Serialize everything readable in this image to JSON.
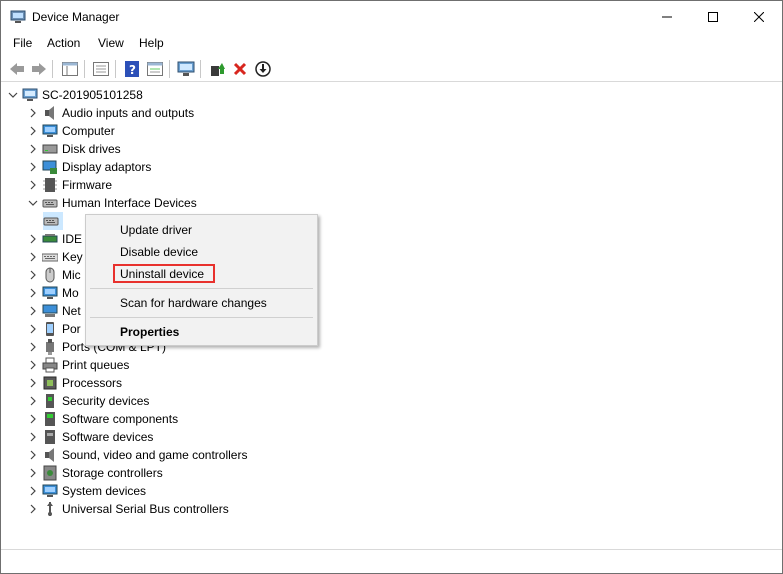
{
  "window": {
    "title": "Device Manager"
  },
  "menu": [
    "File",
    "Action",
    "View",
    "Help"
  ],
  "toolbar_icons": [
    "back-icon",
    "forward-icon",
    "tree-view-icon",
    "list-view-icon",
    "help-icon",
    "properties-icon",
    "scan-hardware-icon",
    "update-driver-icon",
    "uninstall-icon",
    "disable-icon"
  ],
  "tree": {
    "root": "SC-201905101258",
    "items": [
      {
        "label": "Audio inputs and outputs",
        "icon": "speaker-icon"
      },
      {
        "label": "Computer",
        "icon": "monitor-icon"
      },
      {
        "label": "Disk drives",
        "icon": "disk-icon"
      },
      {
        "label": "Display adaptors",
        "icon": "display-adapter-icon"
      },
      {
        "label": "Firmware",
        "icon": "chip-icon"
      },
      {
        "label": "Human Interface Devices",
        "icon": "hid-icon"
      },
      {
        "label": "",
        "icon": "hid-icon"
      },
      {
        "label": "IDE",
        "icon": "ide-icon"
      },
      {
        "label": "Key",
        "icon": "keyboard-icon"
      },
      {
        "label": "Mic",
        "icon": "mouse-icon"
      },
      {
        "label": "Mo",
        "icon": "monitor-icon"
      },
      {
        "label": "Net",
        "icon": "network-icon"
      },
      {
        "label": "Por",
        "icon": "portable-device-icon"
      },
      {
        "label": "Ports (COM & LPT)",
        "icon": "port-icon"
      },
      {
        "label": "Print queues",
        "icon": "printer-icon"
      },
      {
        "label": "Processors",
        "icon": "processor-icon"
      },
      {
        "label": "Security devices",
        "icon": "security-icon"
      },
      {
        "label": "Software components",
        "icon": "software-component-icon"
      },
      {
        "label": "Software devices",
        "icon": "software-device-icon"
      },
      {
        "label": "Sound, video and game controllers",
        "icon": "speaker-icon"
      },
      {
        "label": "Storage controllers",
        "icon": "storage-icon"
      },
      {
        "label": "System devices",
        "icon": "system-icon"
      },
      {
        "label": "Universal Serial Bus controllers",
        "icon": "usb-icon"
      }
    ]
  },
  "context_menu": {
    "items": [
      "Update driver",
      "Disable device",
      "Uninstall device",
      "Scan for hardware changes",
      "Properties"
    ],
    "highlighted": "Uninstall device",
    "highlight_color": "#e8312d"
  }
}
